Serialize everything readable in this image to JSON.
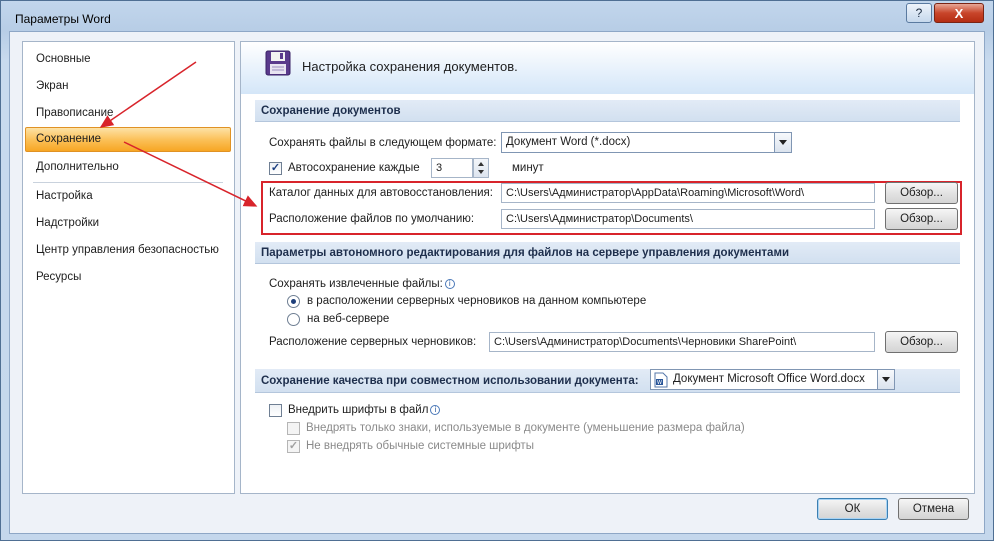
{
  "window": {
    "title": "Параметры Word",
    "help_label": "?",
    "close_label": "X"
  },
  "nav": {
    "items": [
      {
        "label": "Основные"
      },
      {
        "label": "Экран"
      },
      {
        "label": "Правописание"
      },
      {
        "label": "Сохранение"
      },
      {
        "label": "Дополнительно"
      },
      {
        "label": "Настройка"
      },
      {
        "label": "Надстройки"
      },
      {
        "label": "Центр управления безопасностью"
      },
      {
        "label": "Ресурсы"
      }
    ],
    "selected_index": 3
  },
  "header": {
    "title": "Настройка сохранения документов."
  },
  "save_docs": {
    "section_title": "Сохранение документов",
    "format_label": "Сохранять файлы в следующем формате:",
    "format_value": "Документ Word (*.docx)",
    "autosave_label": "Автосохранение каждые",
    "autosave_checked": true,
    "autosave_value": "3",
    "autosave_unit": "минут",
    "autorecover_label": "Каталог данных для автовосстановления:",
    "autorecover_path": "C:\\Users\\Администратор\\AppData\\Roaming\\Microsoft\\Word\\",
    "default_location_label": "Расположение файлов по умолчанию:",
    "default_location_path": "C:\\Users\\Администратор\\Documents\\",
    "browse_label": "Обзор..."
  },
  "offline_editing": {
    "section_title": "Параметры автономного редактирования для файлов на сервере управления документами",
    "save_checked_out_label": "Сохранять извлеченные файлы:",
    "option_local": "в расположении серверных черновиков на данном компьютере",
    "option_web": "на веб-сервере",
    "selected_option": "local",
    "drafts_location_label": "Расположение серверных черновиков:",
    "drafts_location_path": "C:\\Users\\Администратор\\Documents\\Черновики SharePoint\\",
    "browse_label": "Обзор..."
  },
  "fidelity": {
    "section_title": "Сохранение качества при совместном использовании документа:",
    "document_value": "Документ Microsoft Office Word.docx",
    "embed_fonts_label": "Внедрить шрифты в файл",
    "embed_fonts_checked": false,
    "embed_used_chars_label": "Внедрять только знаки, используемые в документе (уменьшение размера файла)",
    "embed_used_chars_checked": false,
    "no_system_fonts_label": "Не внедрять обычные системные шрифты",
    "no_system_fonts_checked": true
  },
  "footer": {
    "ok_label": "ОК",
    "cancel_label": "Отмена"
  },
  "colors": {
    "highlight": "#d8242b",
    "arrow": "#d8242b",
    "selected_nav": "#fbc15a",
    "accent": "#1e2f4d"
  }
}
